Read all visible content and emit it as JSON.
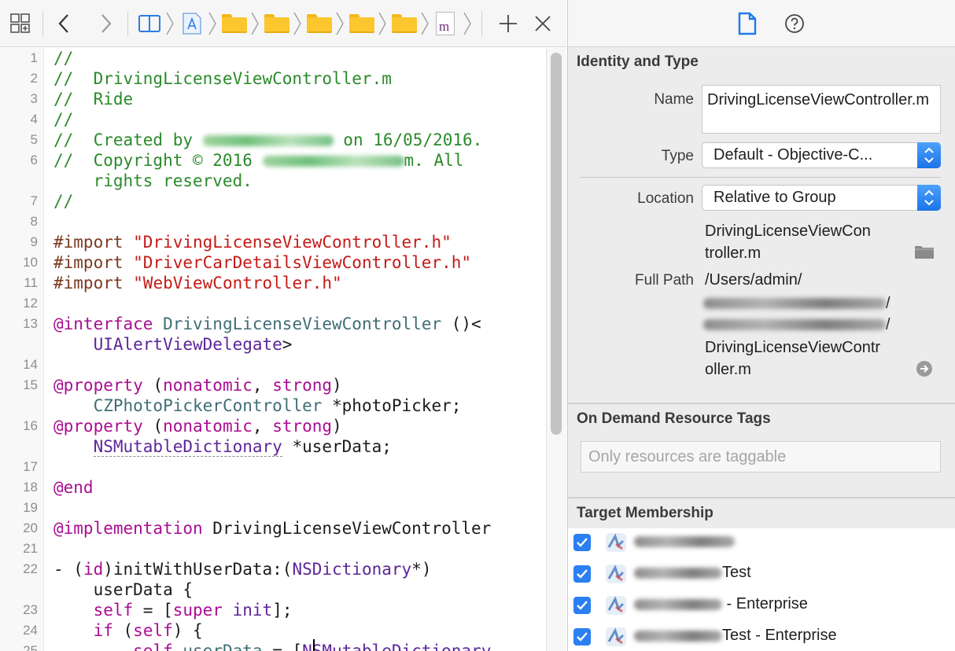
{
  "jumpbar": {
    "file_badge": "m"
  },
  "editor": {
    "lines": [
      {
        "n": "1",
        "segs": [
          {
            "c": "cm",
            "t": "//"
          }
        ]
      },
      {
        "n": "2",
        "segs": [
          {
            "c": "cm",
            "t": "//  DrivingLicenseViewController.m"
          }
        ]
      },
      {
        "n": "3",
        "segs": [
          {
            "c": "cm",
            "t": "//  Ride"
          }
        ]
      },
      {
        "n": "4",
        "segs": [
          {
            "c": "cm",
            "t": "//"
          }
        ]
      },
      {
        "n": "5",
        "segs": [
          {
            "c": "cm",
            "t": "//  Created by "
          },
          {
            "c": "blur",
            "w": 166
          },
          {
            "c": "cm",
            "t": " on 16/05/2016."
          }
        ]
      },
      {
        "n": "6",
        "segs": [
          {
            "c": "cm",
            "t": "//  Copyright © 2016 "
          },
          {
            "c": "blur",
            "w": 180
          },
          {
            "c": "cm",
            "t": "m. All"
          }
        ]
      },
      {
        "n": "",
        "segs": [
          {
            "c": "cm",
            "t": "    rights reserved."
          }
        ]
      },
      {
        "n": "7",
        "segs": [
          {
            "c": "cm",
            "t": "//"
          }
        ]
      },
      {
        "n": "8",
        "segs": []
      },
      {
        "n": "9",
        "segs": [
          {
            "c": "pp",
            "t": "#import "
          },
          {
            "c": "str",
            "t": "\"DrivingLicenseViewController.h\""
          }
        ]
      },
      {
        "n": "10",
        "segs": [
          {
            "c": "pp",
            "t": "#import "
          },
          {
            "c": "str",
            "t": "\"DriverCarDetailsViewController.h\""
          }
        ]
      },
      {
        "n": "11",
        "segs": [
          {
            "c": "pp",
            "t": "#import "
          },
          {
            "c": "str",
            "t": "\"WebViewController.h\""
          }
        ]
      },
      {
        "n": "12",
        "segs": []
      },
      {
        "n": "13",
        "segs": [
          {
            "c": "kw",
            "t": "@interface"
          },
          {
            "c": "",
            "t": " "
          },
          {
            "c": "pt",
            "t": "DrivingLicenseViewController"
          },
          {
            "c": "",
            "t": " ()<"
          }
        ]
      },
      {
        "n": "",
        "segs": [
          {
            "c": "",
            "t": "    "
          },
          {
            "c": "ty",
            "t": "UIAlertViewDelegate"
          },
          {
            "c": "",
            "t": ">"
          }
        ]
      },
      {
        "n": "14",
        "segs": []
      },
      {
        "n": "15",
        "segs": [
          {
            "c": "kw",
            "t": "@property"
          },
          {
            "c": "",
            "t": " ("
          },
          {
            "c": "kw",
            "t": "nonatomic"
          },
          {
            "c": "",
            "t": ", "
          },
          {
            "c": "kw",
            "t": "strong"
          },
          {
            "c": "",
            "t": ")"
          }
        ]
      },
      {
        "n": "",
        "segs": [
          {
            "c": "",
            "t": "    "
          },
          {
            "c": "pt",
            "t": "CZPhotoPickerController"
          },
          {
            "c": "",
            "t": " *photoPicker;"
          }
        ]
      },
      {
        "n": "16",
        "segs": [
          {
            "c": "kw",
            "t": "@property"
          },
          {
            "c": "",
            "t": " ("
          },
          {
            "c": "kw",
            "t": "nonatomic"
          },
          {
            "c": "",
            "t": ", "
          },
          {
            "c": "kw",
            "t": "strong"
          },
          {
            "c": "",
            "t": ")"
          }
        ]
      },
      {
        "n": "",
        "segs": [
          {
            "c": "",
            "t": "    "
          },
          {
            "c": "ty dash-under",
            "t": "NSMutableDictionary"
          },
          {
            "c": "",
            "t": " *userData;"
          }
        ]
      },
      {
        "n": "17",
        "segs": []
      },
      {
        "n": "18",
        "segs": [
          {
            "c": "kw",
            "t": "@end"
          }
        ]
      },
      {
        "n": "19",
        "segs": []
      },
      {
        "n": "20",
        "segs": [
          {
            "c": "kw",
            "t": "@implementation"
          },
          {
            "c": "",
            "t": " DrivingLicenseViewController"
          }
        ]
      },
      {
        "n": "21",
        "segs": []
      },
      {
        "n": "22",
        "segs": [
          {
            "c": "",
            "t": "- ("
          },
          {
            "c": "kw",
            "t": "id"
          },
          {
            "c": "",
            "t": ")initWithUserData:("
          },
          {
            "c": "ty",
            "t": "NSDictionary"
          },
          {
            "c": "",
            "t": "*)"
          }
        ]
      },
      {
        "n": "",
        "segs": [
          {
            "c": "",
            "t": "    userData {"
          }
        ]
      },
      {
        "n": "23",
        "segs": [
          {
            "c": "",
            "t": "    "
          },
          {
            "c": "kw",
            "t": "self"
          },
          {
            "c": "",
            "t": " = ["
          },
          {
            "c": "kw",
            "t": "super"
          },
          {
            "c": "",
            "t": " "
          },
          {
            "c": "ty",
            "t": "init"
          },
          {
            "c": "",
            "t": "];"
          }
        ]
      },
      {
        "n": "24",
        "segs": [
          {
            "c": "",
            "t": "    "
          },
          {
            "c": "kw",
            "t": "if"
          },
          {
            "c": "",
            "t": " ("
          },
          {
            "c": "kw",
            "t": "self"
          },
          {
            "c": "",
            "t": ") {"
          }
        ]
      },
      {
        "n": "25",
        "segs": [
          {
            "c": "",
            "t": "        "
          },
          {
            "c": "kw",
            "t": "self"
          },
          {
            "c": "",
            "t": "."
          },
          {
            "c": "pt",
            "t": "userData"
          },
          {
            "c": "",
            "t": " = ["
          },
          {
            "c": "ty",
            "t": "NSMutableDictionary"
          }
        ]
      }
    ]
  },
  "inspector": {
    "identity": {
      "title": "Identity and Type",
      "name_label": "Name",
      "name_value": "DrivingLicenseViewController.m",
      "type_label": "Type",
      "type_value": "Default - Objective-C...",
      "location_label": "Location",
      "location_value": "Relative to Group",
      "location_file_line1": "DrivingLicenseViewCon",
      "location_file_line2": "troller.m",
      "fullpath_label": "Full Path",
      "fullpath_line1": "/Users/admin/",
      "fullpath_sep": "/",
      "fullpath_line4": "DrivingLicenseViewContr",
      "fullpath_line5": "oller.m"
    },
    "odr": {
      "title": "On Demand Resource Tags",
      "placeholder": "Only resources are taggable"
    },
    "targets": {
      "title": "Target Membership",
      "items": [
        {
          "suffix": "",
          "checked": true
        },
        {
          "suffix": "Test",
          "checked": true
        },
        {
          "suffix": " - Enterprise",
          "checked": true
        },
        {
          "suffix": "Test - Enterprise",
          "checked": true
        }
      ]
    }
  },
  "colors": {
    "accent": "#2a7ff2",
    "comment": "#2b8a2b",
    "string": "#c41a16",
    "keyword": "#aa0d91"
  }
}
